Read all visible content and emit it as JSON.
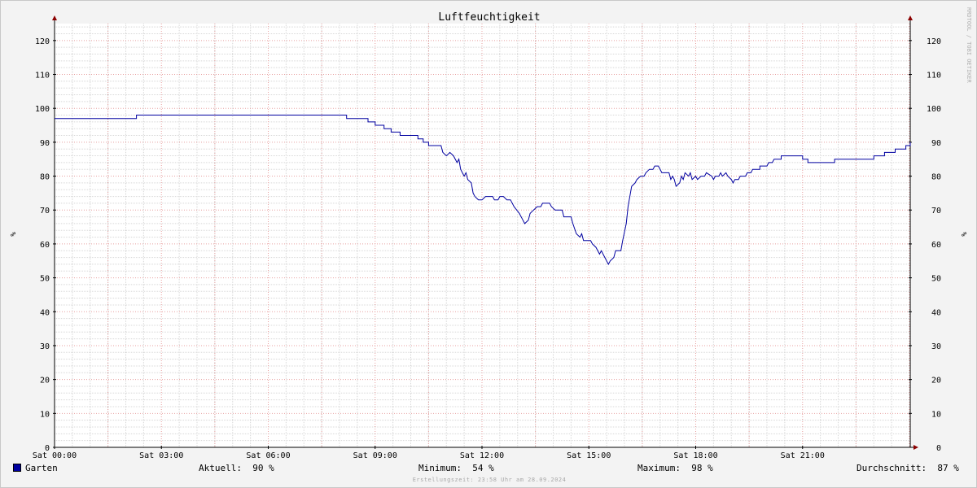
{
  "chart_data": {
    "type": "line",
    "title": "Luftfeuchtigkeit",
    "ylabel": "%",
    "ylim": [
      0,
      125
    ],
    "y_ticks": [
      0,
      10,
      20,
      30,
      40,
      50,
      60,
      70,
      80,
      90,
      100,
      110,
      120
    ],
    "x_range_hours": [
      0,
      24
    ],
    "x_ticks": [
      {
        "h": 0,
        "label": "Sat 00:00"
      },
      {
        "h": 3,
        "label": "Sat 03:00"
      },
      {
        "h": 6,
        "label": "Sat 06:00"
      },
      {
        "h": 9,
        "label": "Sat 09:00"
      },
      {
        "h": 12,
        "label": "Sat 12:00"
      },
      {
        "h": 15,
        "label": "Sat 15:00"
      },
      {
        "h": 18,
        "label": "Sat 18:00"
      },
      {
        "h": 21,
        "label": "Sat 21:00"
      }
    ],
    "grid": true,
    "series": [
      {
        "name": "Garten",
        "color": "#0000a0",
        "points": [
          [
            0,
            97
          ],
          [
            2.3,
            97
          ],
          [
            2.3,
            98
          ],
          [
            8.2,
            98
          ],
          [
            8.2,
            97
          ],
          [
            8.8,
            97
          ],
          [
            8.8,
            96
          ],
          [
            9.0,
            96
          ],
          [
            9.0,
            95
          ],
          [
            9.25,
            95
          ],
          [
            9.25,
            94
          ],
          [
            9.45,
            94
          ],
          [
            9.45,
            93
          ],
          [
            9.7,
            93
          ],
          [
            9.7,
            92
          ],
          [
            10.2,
            92
          ],
          [
            10.2,
            91
          ],
          [
            10.35,
            91
          ],
          [
            10.35,
            90
          ],
          [
            10.5,
            90
          ],
          [
            10.5,
            89
          ],
          [
            10.85,
            89
          ],
          [
            10.9,
            87
          ],
          [
            11.0,
            86
          ],
          [
            11.1,
            87
          ],
          [
            11.2,
            86
          ],
          [
            11.3,
            84
          ],
          [
            11.35,
            85
          ],
          [
            11.4,
            82
          ],
          [
            11.5,
            80
          ],
          [
            11.55,
            81
          ],
          [
            11.6,
            79
          ],
          [
            11.7,
            78
          ],
          [
            11.75,
            75
          ],
          [
            11.8,
            74
          ],
          [
            11.9,
            73
          ],
          [
            12.0,
            73
          ],
          [
            12.1,
            74
          ],
          [
            12.3,
            74
          ],
          [
            12.35,
            73
          ],
          [
            12.45,
            73
          ],
          [
            12.5,
            74
          ],
          [
            12.6,
            74
          ],
          [
            12.7,
            73
          ],
          [
            12.8,
            73
          ],
          [
            12.9,
            71
          ],
          [
            13.05,
            69
          ],
          [
            13.15,
            67
          ],
          [
            13.2,
            66
          ],
          [
            13.3,
            67
          ],
          [
            13.35,
            69
          ],
          [
            13.45,
            70
          ],
          [
            13.55,
            71
          ],
          [
            13.65,
            71
          ],
          [
            13.7,
            72
          ],
          [
            13.9,
            72
          ],
          [
            13.95,
            71
          ],
          [
            14.05,
            70
          ],
          [
            14.25,
            70
          ],
          [
            14.3,
            68
          ],
          [
            14.5,
            68
          ],
          [
            14.55,
            66
          ],
          [
            14.65,
            63
          ],
          [
            14.75,
            62
          ],
          [
            14.8,
            63
          ],
          [
            14.85,
            61
          ],
          [
            15.05,
            61
          ],
          [
            15.1,
            60
          ],
          [
            15.2,
            59
          ],
          [
            15.3,
            57
          ],
          [
            15.35,
            58
          ],
          [
            15.45,
            56
          ],
          [
            15.5,
            55
          ],
          [
            15.55,
            54
          ],
          [
            15.6,
            55
          ],
          [
            15.7,
            56
          ],
          [
            15.75,
            58
          ],
          [
            15.9,
            58
          ],
          [
            15.95,
            61
          ],
          [
            16.05,
            66
          ],
          [
            16.1,
            71
          ],
          [
            16.15,
            74
          ],
          [
            16.2,
            77
          ],
          [
            16.3,
            78
          ],
          [
            16.35,
            79
          ],
          [
            16.45,
            80
          ],
          [
            16.55,
            80
          ],
          [
            16.6,
            81
          ],
          [
            16.7,
            82
          ],
          [
            16.8,
            82
          ],
          [
            16.85,
            83
          ],
          [
            16.95,
            83
          ],
          [
            17.0,
            82
          ],
          [
            17.05,
            81
          ],
          [
            17.25,
            81
          ],
          [
            17.3,
            79
          ],
          [
            17.35,
            80
          ],
          [
            17.4,
            79
          ],
          [
            17.45,
            77
          ],
          [
            17.55,
            78
          ],
          [
            17.6,
            80
          ],
          [
            17.65,
            79
          ],
          [
            17.7,
            81
          ],
          [
            17.8,
            80
          ],
          [
            17.85,
            81
          ],
          [
            17.9,
            79
          ],
          [
            18.0,
            80
          ],
          [
            18.05,
            79
          ],
          [
            18.15,
            80
          ],
          [
            18.25,
            80
          ],
          [
            18.3,
            81
          ],
          [
            18.45,
            80
          ],
          [
            18.5,
            79
          ],
          [
            18.55,
            80
          ],
          [
            18.65,
            80
          ],
          [
            18.7,
            81
          ],
          [
            18.75,
            80
          ],
          [
            18.85,
            81
          ],
          [
            18.9,
            80
          ],
          [
            19.0,
            79
          ],
          [
            19.05,
            78
          ],
          [
            19.1,
            79
          ],
          [
            19.2,
            79
          ],
          [
            19.25,
            80
          ],
          [
            19.4,
            80
          ],
          [
            19.45,
            81
          ],
          [
            19.55,
            81
          ],
          [
            19.6,
            82
          ],
          [
            19.8,
            82
          ],
          [
            19.8,
            83
          ],
          [
            20.0,
            83
          ],
          [
            20.05,
            84
          ],
          [
            20.15,
            84
          ],
          [
            20.2,
            85
          ],
          [
            20.4,
            85
          ],
          [
            20.4,
            86
          ],
          [
            21.0,
            86
          ],
          [
            21.0,
            85
          ],
          [
            21.15,
            85
          ],
          [
            21.15,
            84
          ],
          [
            21.9,
            84
          ],
          [
            21.9,
            85
          ],
          [
            23.0,
            85
          ],
          [
            23.0,
            86
          ],
          [
            23.3,
            86
          ],
          [
            23.3,
            87
          ],
          [
            23.6,
            87
          ],
          [
            23.6,
            88
          ],
          [
            23.9,
            88
          ],
          [
            23.9,
            89
          ],
          [
            24.9,
            89
          ],
          [
            24.9,
            90
          ],
          [
            26.2,
            90
          ]
        ]
      }
    ],
    "legend": {
      "series_name": "Garten",
      "aktuell": "Aktuell:  90 %",
      "minimum": "Minimum:  54 %",
      "maximum": "Maximum:  98 %",
      "durchschnitt": "Durchschnitt:  87 %"
    }
  },
  "footer": "Erstellungszeit: 23:58 Uhr am 28.09.2024",
  "watermark": "RRDTOOL / TOBI OETIKER"
}
